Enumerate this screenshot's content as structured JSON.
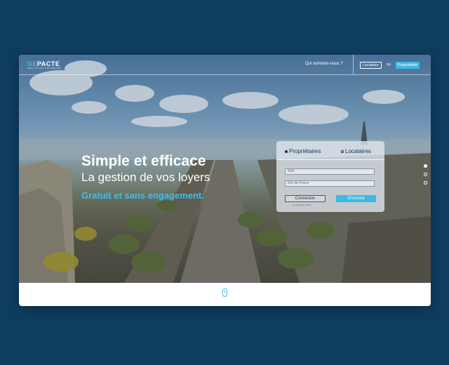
{
  "brand": {
    "name_a": "GE",
    "name_b": "PACTE",
    "tagline": "GESTION DES PATRIMOINES"
  },
  "nav": {
    "about": "Qui sommes-nous ?",
    "locataire": "Locataire",
    "ou": "ou",
    "proprietaire": "Propriétaire"
  },
  "hero": {
    "title": "Simple et efficace",
    "subtitle": "La gestion de vos loyers",
    "tagline": "Gratuit et sans engagement."
  },
  "login": {
    "radio_owner": "Propriétaires",
    "radio_tenant": "Locataires",
    "email_placeholder": "Mail",
    "password_placeholder": "Mot de Passe",
    "connexion": "Connexion",
    "forgot": "mot de passe oublié ?",
    "inscrire": "S'inscrire"
  },
  "slides": {
    "count": 3,
    "active": 1
  },
  "colors": {
    "accent": "#3fb9e3",
    "background": "#0f3d5f"
  }
}
